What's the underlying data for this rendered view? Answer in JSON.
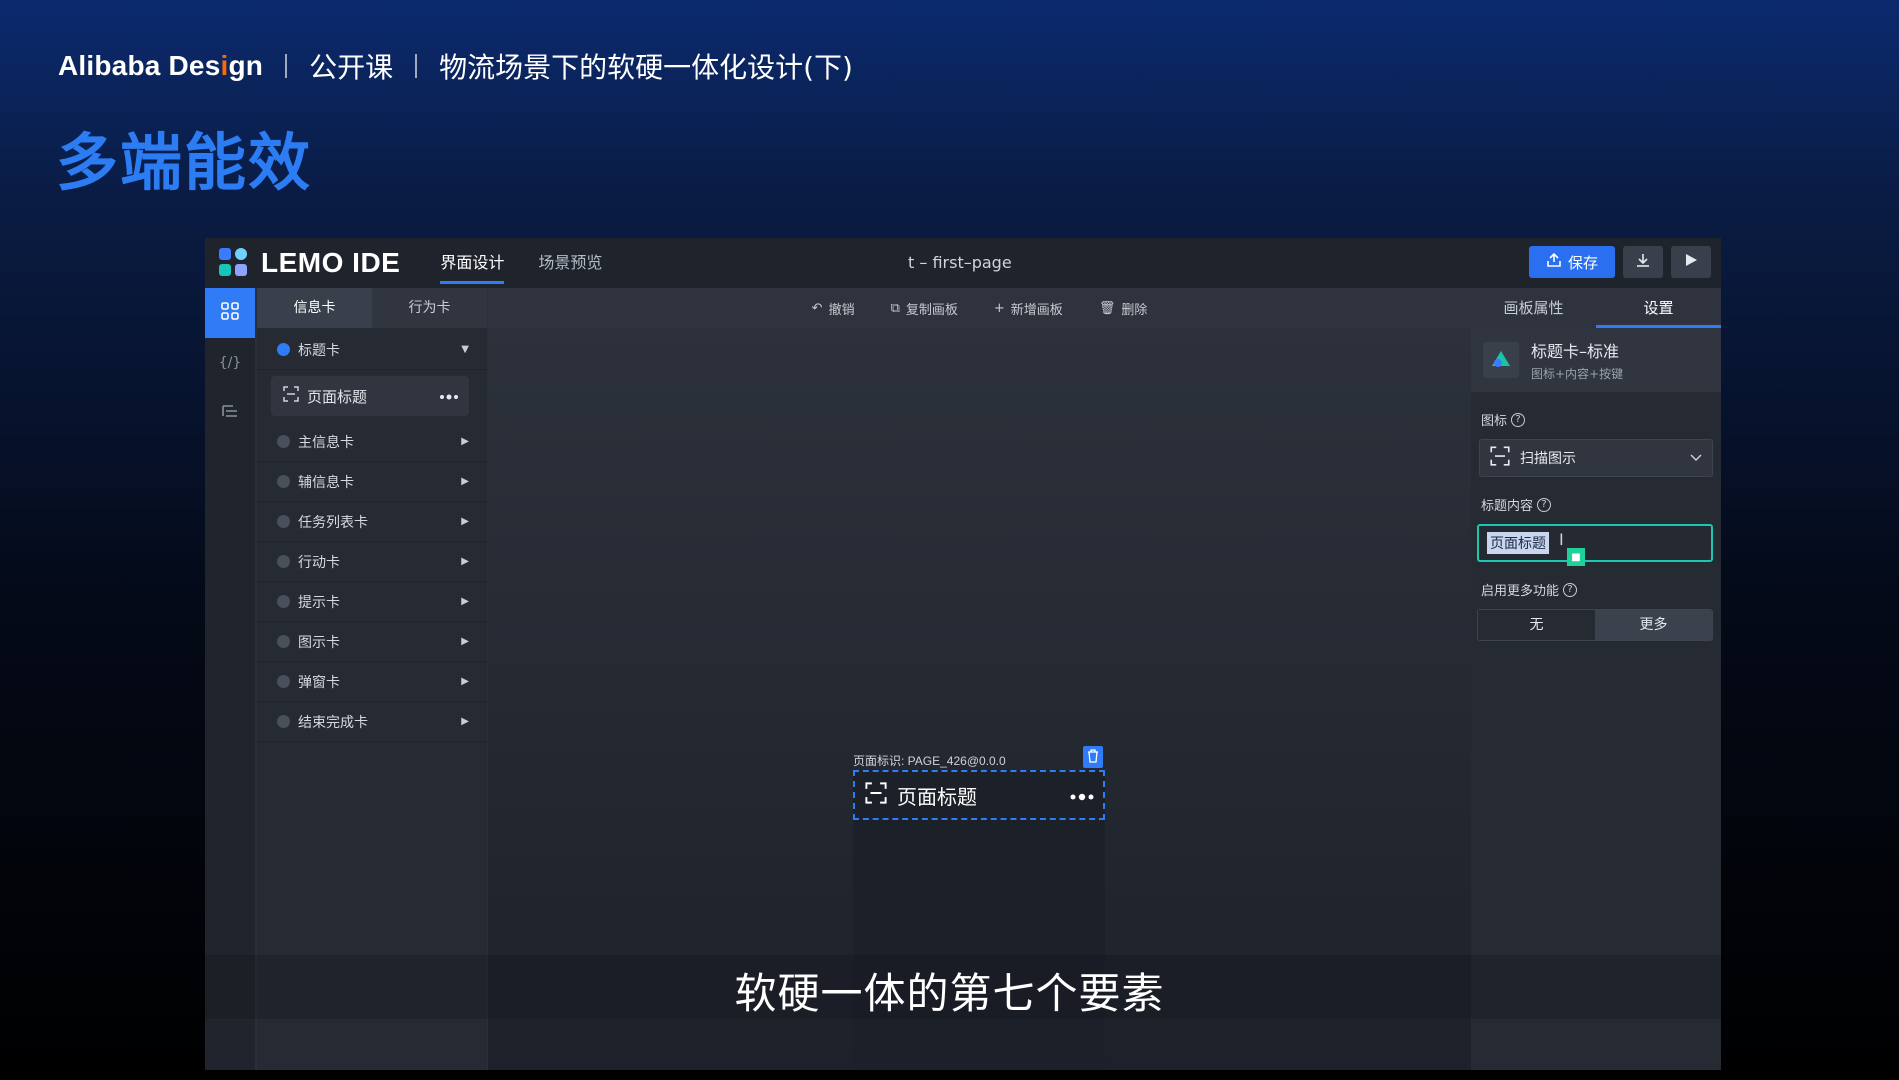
{
  "slide": {
    "brand": "Alibaba Design",
    "course": "公开课",
    "topic": "物流场景下的软硬一体化设计(下)",
    "title": "多端能效"
  },
  "ide": {
    "logo_text": "LEMO IDE",
    "tabs": [
      "界面设计",
      "场景预览"
    ],
    "active_tab": "界面设计",
    "page_name": "t – first–page",
    "save_label": "保存",
    "toolbar": {
      "undo": "撤销",
      "copy_board": "复制画板",
      "add_board": "新增画板",
      "delete": "删除"
    },
    "left_panel": {
      "tabs": [
        "信息卡",
        "行为卡"
      ],
      "active_tab": "信息卡",
      "open_category": "标题卡",
      "open_item": "页面标题",
      "categories": [
        "主信息卡",
        "辅信息卡",
        "任务列表卡",
        "行动卡",
        "提示卡",
        "图示卡",
        "弹窗卡",
        "结束完成卡"
      ]
    },
    "canvas": {
      "page_meta": "页面标识: PAGE_426@0.0.0",
      "header_label": "页面标题"
    },
    "props": {
      "tabs": [
        "画板属性",
        "设置"
      ],
      "active_tab": "设置",
      "card_title": "标题卡–标准",
      "card_sub": "图标+内容+按键",
      "icon_label": "图标",
      "icon_value": "扫描图示",
      "title_content_label": "标题内容",
      "title_content_value": "页面标题",
      "more_label": "启用更多功能",
      "more_options": [
        "无",
        "更多"
      ],
      "more_selected": "更多"
    },
    "colors": {
      "accent": "#2f7cf6",
      "focus": "#1cc7b2"
    }
  },
  "subtitle": "软硬一体的第七个要素"
}
